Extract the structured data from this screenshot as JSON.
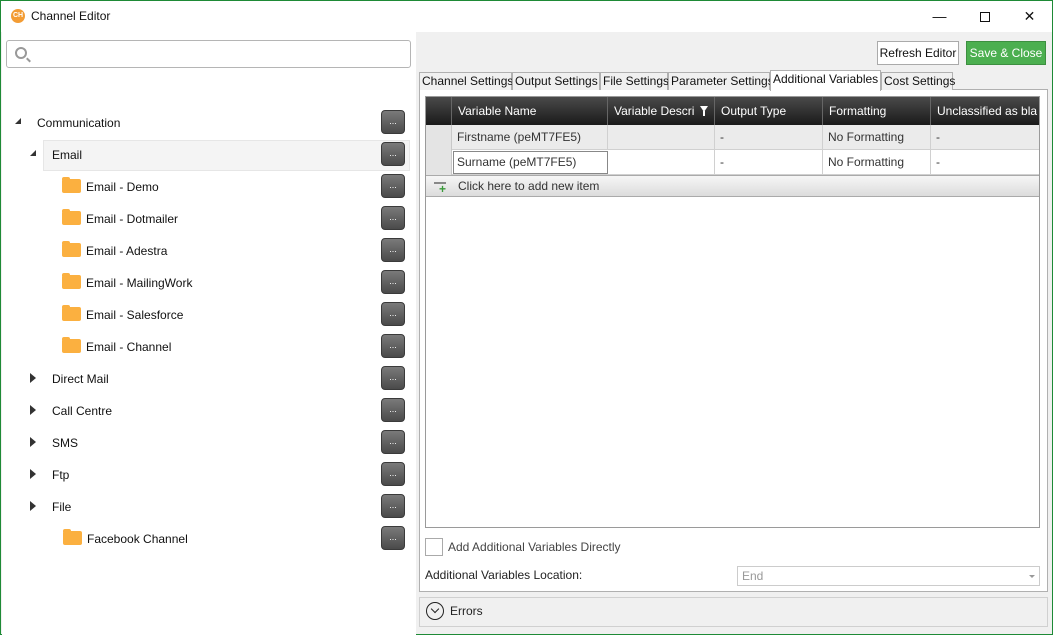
{
  "window": {
    "app_icon_text": "CH",
    "title": "Channel Editor",
    "minimize_glyph": "—",
    "close_glyph": "✕"
  },
  "toolbar": {
    "refresh_label": "Refresh Editor",
    "save_label": "Save & Close"
  },
  "search": {
    "placeholder": "",
    "value": ""
  },
  "tree": {
    "more_label": "...",
    "items": [
      {
        "label": "Communication",
        "level": 0,
        "expander": "open",
        "folder": false
      },
      {
        "label": "Email",
        "level": 1,
        "expander": "open",
        "folder": false,
        "selected": true
      },
      {
        "label": "Email - Demo",
        "level": 2,
        "folder": true
      },
      {
        "label": "Email - Dotmailer",
        "level": 2,
        "folder": true
      },
      {
        "label": "Email - Adestra",
        "level": 2,
        "folder": true
      },
      {
        "label": "Email - MailingWork",
        "level": 2,
        "folder": true
      },
      {
        "label": "Email - Salesforce",
        "level": 2,
        "folder": true
      },
      {
        "label": "Email - Channel",
        "level": 2,
        "folder": true
      },
      {
        "label": "Direct Mail",
        "level": 1,
        "expander": "closed",
        "folder": false
      },
      {
        "label": "Call Centre",
        "level": 1,
        "expander": "closed",
        "folder": false
      },
      {
        "label": "SMS",
        "level": 1,
        "expander": "closed",
        "folder": false
      },
      {
        "label": "Ftp",
        "level": 1,
        "expander": "closed",
        "folder": false
      },
      {
        "label": "File",
        "level": 1,
        "expander": "closed",
        "folder": false
      },
      {
        "label": "Facebook Channel",
        "level": 1,
        "folder": true
      }
    ]
  },
  "tabs": [
    {
      "label": "Channel Settings"
    },
    {
      "label": "Output Settings"
    },
    {
      "label": "File Settings"
    },
    {
      "label": "Parameter Settings"
    },
    {
      "label": "Additional Variables",
      "active": true
    },
    {
      "label": "Cost Settings"
    }
  ],
  "grid": {
    "columns": [
      "Variable Name",
      "Variable Descri",
      "Output Type",
      "Formatting",
      "Unclassified as bla"
    ],
    "rows": [
      [
        "Firstname (peMT7FE5)",
        "",
        "-",
        "No Formatting",
        "-"
      ],
      [
        "Surname  (peMT7FE5)",
        "",
        "-",
        "No Formatting",
        "-"
      ]
    ],
    "add_row_label": "Click here to add new item"
  },
  "options": {
    "add_directly_label": "Add Additional Variables Directly",
    "add_directly_checked": false,
    "location_label": "Additional Variables Location:",
    "location_value": "End"
  },
  "errors": {
    "label": "Errors"
  },
  "colors": {
    "accent_green": "#4caf50",
    "folder_orange": "#fbb040",
    "header_dark": "#1a1a1a"
  }
}
